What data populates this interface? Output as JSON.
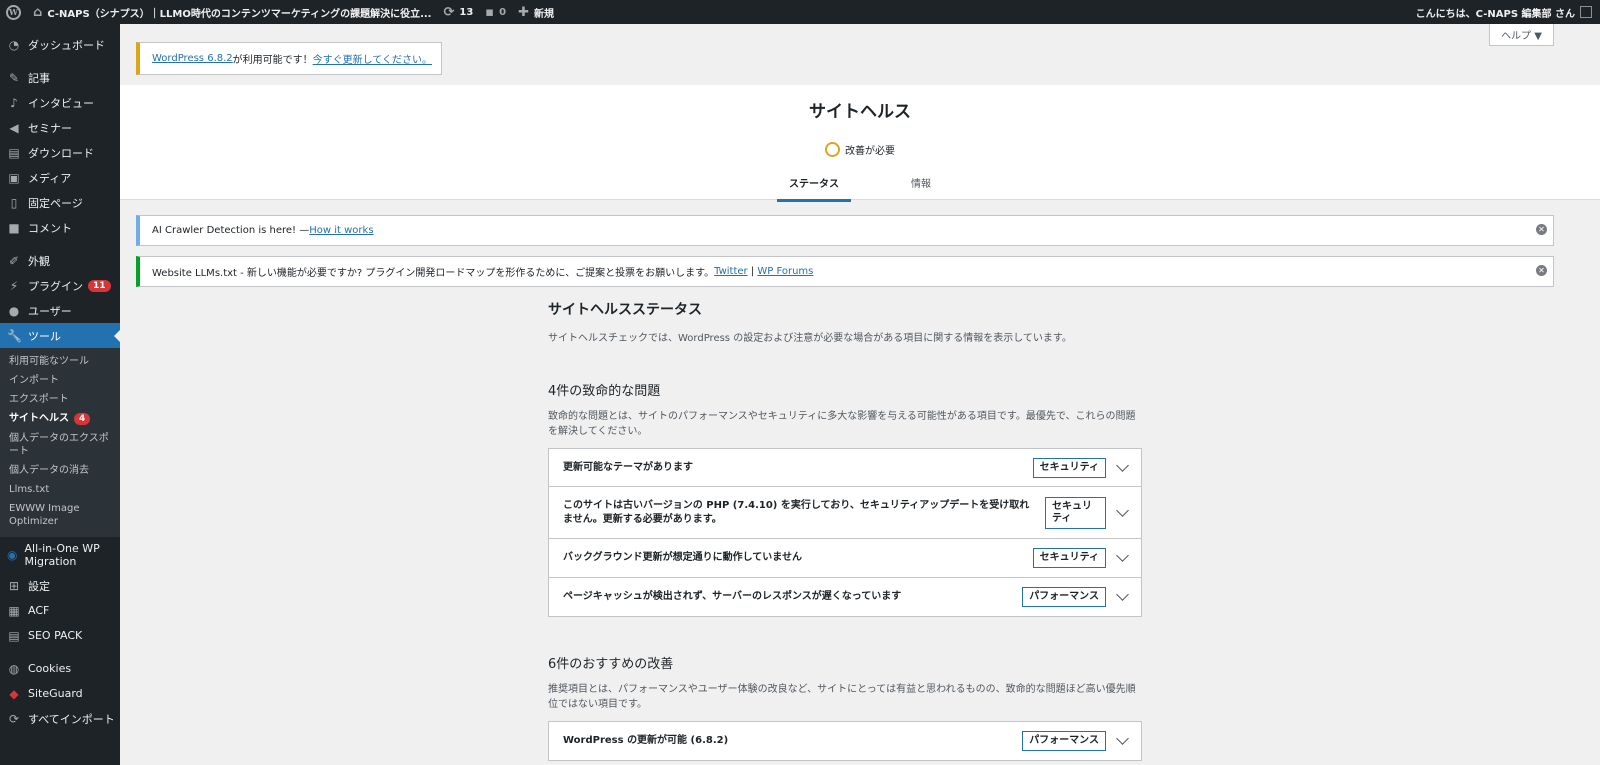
{
  "adminbar": {
    "site_name": "C-NAPS（シナプス）｜LLMO時代のコンテンツマーケティングの課題解決に役立...",
    "updates_count": "13",
    "comments_count": "0",
    "new_label": "新規",
    "greeting": "こんにちは、C-NAPS 編集部 さん"
  },
  "sidebar": {
    "items": [
      {
        "label": "ダッシュボード",
        "icon": "gauge-icon"
      },
      {
        "label": "記事",
        "icon": "pin-icon"
      },
      {
        "label": "インタビュー",
        "icon": "microphone-icon"
      },
      {
        "label": "セミナー",
        "icon": "megaphone-icon"
      },
      {
        "label": "ダウンロード",
        "icon": "document-icon"
      },
      {
        "label": "メディア",
        "icon": "media-icon"
      },
      {
        "label": "固定ページ",
        "icon": "page-icon"
      },
      {
        "label": "コメント",
        "icon": "comment-icon"
      },
      {
        "label": "外観",
        "icon": "paintbrush-icon"
      },
      {
        "label": "プラグイン",
        "icon": "plugin-icon",
        "badge": "11"
      },
      {
        "label": "ユーザー",
        "icon": "user-icon"
      },
      {
        "label": "ツール",
        "icon": "wrench-icon"
      }
    ],
    "tools_submenu": [
      {
        "label": "利用可能なツール"
      },
      {
        "label": "インポート"
      },
      {
        "label": "エクスポート"
      },
      {
        "label": "サイトヘルス",
        "badge": "4"
      },
      {
        "label": "個人データのエクスポート"
      },
      {
        "label": "個人データの消去"
      },
      {
        "label": "Llms.txt"
      },
      {
        "label": "EWWW Image Optimizer"
      }
    ],
    "items_after": [
      {
        "label": "All-in-One WP Migration",
        "icon": "migration-icon"
      },
      {
        "label": "設定",
        "icon": "settings-icon"
      },
      {
        "label": "ACF",
        "icon": "acf-icon"
      },
      {
        "label": "SEO PACK",
        "icon": "seo-icon"
      },
      {
        "label": "Cookies",
        "icon": "cookie-icon"
      },
      {
        "label": "SiteGuard",
        "icon": "shield-icon"
      },
      {
        "label": "すべてインポート",
        "icon": "import-icon"
      }
    ]
  },
  "help_label": "ヘルプ ▼",
  "update_nag": {
    "version_link": "WordPress 6.8.2",
    "text": " が利用可能です！",
    "update_link": "今すぐ更新してください。"
  },
  "health": {
    "title": "サイトヘルス",
    "status": "改善が必要",
    "tabs": [
      "ステータス",
      "情報"
    ]
  },
  "notices": {
    "crawler": {
      "text": "AI Crawler Detection is here! — ",
      "link": "How it works"
    },
    "llms": {
      "text": "Website LLMs.txt - 新しい機能が必要ですか? プラグイン開発ロードマップを形作るために、ご提案と投票をお願いします。 ",
      "link1": "Twitter",
      "sep": " | ",
      "link2": "WP Forums"
    }
  },
  "status_section": {
    "title": "サイトヘルスステータス",
    "description": "サイトヘルスチェックでは、WordPress の設定および注意が必要な場合がある項目に関する情報を表示しています。"
  },
  "critical": {
    "title": "4件の致命的な問題",
    "description": "致命的な問題とは、サイトのパフォーマンスやセキュリティに多大な影響を与える可能性がある項目です。最優先で、これらの問題を解決してください。",
    "issues": [
      {
        "text": "更新可能なテーマがあります",
        "tag": "セキュリティ"
      },
      {
        "text": "このサイトは古いバージョンの PHP (7.4.10) を実行しており、セキュリティアップデートを受け取れません。更新する必要があります。",
        "tag": "セキュリティ"
      },
      {
        "text": "バックグラウンド更新が想定通りに動作していません",
        "tag": "セキュリティ"
      },
      {
        "text": "ページキャッシュが検出されず、サーバーのレスポンスが遅くなっています",
        "tag": "パフォーマンス"
      }
    ]
  },
  "recommended": {
    "title": "6件のおすすめの改善",
    "description": "推奨項目とは、パフォーマンスやユーザー体験の改良など、サイトにとっては有益と思われるものの、致命的な問題ほど高い優先順位ではない項目です。",
    "issues": [
      {
        "text": "WordPress の更新が可能 (6.8.2)",
        "tag": "パフォーマンス"
      }
    ]
  }
}
